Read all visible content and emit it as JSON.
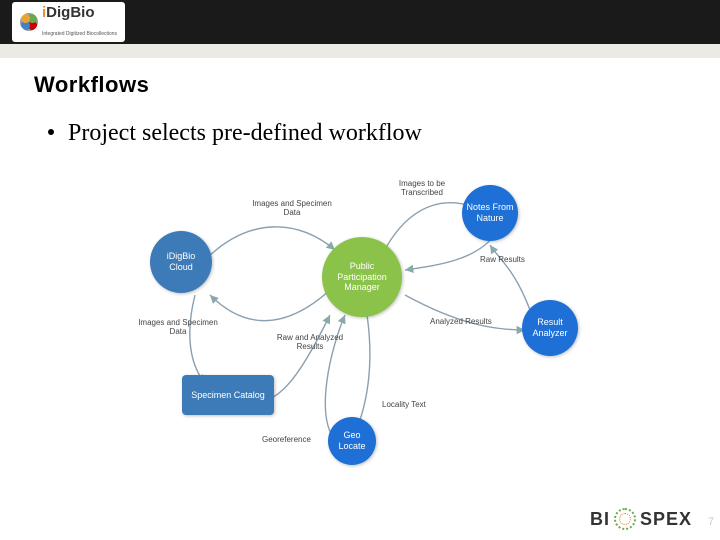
{
  "header": {
    "logo_main": "iDigBio",
    "logo_sub": "Integrated Digitized Biocollections"
  },
  "title": "Workflows",
  "bullet": "Project selects pre-defined workflow",
  "nodes": {
    "idigbio": {
      "label": "iDigBio Cloud",
      "color": "#3d7bb8"
    },
    "specimen": {
      "label": "Specimen Catalog",
      "color": "#3d7bb8"
    },
    "ppm": {
      "label": "Public Participation Manager",
      "color": "#8bc34a"
    },
    "nfn": {
      "label": "Notes From Nature",
      "color": "#1e6fd6"
    },
    "analyzer": {
      "label": "Result Analyzer",
      "color": "#1e6fd6"
    },
    "geolocate": {
      "label": "Geo Locate",
      "color": "#1e6fd6"
    }
  },
  "edges": {
    "e1": "Images and Specimen Data",
    "e2": "Images and Specimen Data",
    "e3": "Raw and Analyzed Results",
    "e4": "Georeference",
    "e5": "Locality Text",
    "e6": "Images to be Transcribed",
    "e7": "Raw Results",
    "e8": "Analyzed Results"
  },
  "footer": {
    "brand_a": "BI",
    "brand_b": "SPEX"
  },
  "slide_number": "7"
}
